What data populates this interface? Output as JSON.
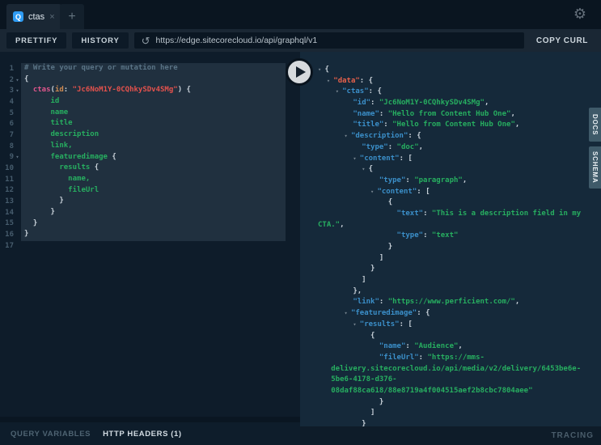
{
  "tabbar": {
    "active_tab": {
      "icon": "Q",
      "label": "ctas",
      "close": "×"
    },
    "new_tab": "+",
    "gear_icon": "⚙"
  },
  "toolbar": {
    "prettify": "PRETTIFY",
    "history": "HISTORY",
    "url": "https://edge.sitecorecloud.io/api/graphql/v1",
    "reload_icon": "↺",
    "copy_curl": "COPY CURL"
  },
  "side_tabs": [
    {
      "label": "DOCS"
    },
    {
      "label": "SCHEMA"
    }
  ],
  "bottom": {
    "query_variables": "QUERY VARIABLES",
    "http_headers": "HTTP HEADERS (1)",
    "tracing": "TRACING"
  },
  "colors": {
    "tab_icon_blue": "#2f9cf4",
    "field_green": "#27ae60",
    "key_blue": "#3b8fc9",
    "data_key_red": "#e8614b",
    "root_field_pink": "#e0568c",
    "string_red": "#e5524d",
    "arg_orange": "#cf8a50",
    "editor_bg": "#0e1c2a",
    "response_bg": "#15293a",
    "selection_bg": "#20303f",
    "side_tab_bg": "#3f5a69"
  },
  "editor": {
    "fold_arrow": "▾ ",
    "lines": [
      {
        "fold": false,
        "tokens": [
          [
            "com",
            "# Write your query or mutation here"
          ]
        ]
      },
      {
        "fold": true,
        "tokens": [
          [
            "punc",
            "{"
          ]
        ]
      },
      {
        "fold": true,
        "tokens": [
          [
            "punc",
            "  "
          ],
          [
            "root",
            "ctas"
          ],
          [
            "punc",
            "("
          ],
          [
            "arg",
            "id"
          ],
          [
            "punc",
            ": "
          ],
          [
            "str",
            "\"Jc6NoM1Y-0CQhkySDv4SMg\""
          ],
          [
            "punc",
            ") {"
          ]
        ]
      },
      {
        "fold": false,
        "tokens": [
          [
            "field",
            "      id"
          ]
        ]
      },
      {
        "fold": false,
        "tokens": [
          [
            "field",
            "      name"
          ]
        ]
      },
      {
        "fold": false,
        "tokens": [
          [
            "field",
            "      title"
          ]
        ]
      },
      {
        "fold": false,
        "tokens": [
          [
            "field",
            "      description"
          ]
        ]
      },
      {
        "fold": false,
        "tokens": [
          [
            "field",
            "      link,"
          ]
        ]
      },
      {
        "fold": true,
        "tokens": [
          [
            "field",
            "      featuredimage"
          ],
          [
            "punc",
            " {"
          ]
        ]
      },
      {
        "fold": false,
        "tokens": [
          [
            "field",
            "        results"
          ],
          [
            "punc",
            " {"
          ]
        ]
      },
      {
        "fold": false,
        "tokens": [
          [
            "field",
            "          name,"
          ]
        ]
      },
      {
        "fold": false,
        "tokens": [
          [
            "field",
            "          fileUrl"
          ]
        ]
      },
      {
        "fold": false,
        "tokens": [
          [
            "punc",
            "        }"
          ]
        ]
      },
      {
        "fold": false,
        "tokens": [
          [
            "punc",
            "      }"
          ]
        ]
      },
      {
        "fold": false,
        "tokens": [
          [
            "punc",
            "  }"
          ]
        ]
      },
      {
        "fold": false,
        "tokens": [
          [
            "punc",
            "}"
          ]
        ]
      },
      {
        "fold": false,
        "tokens": []
      }
    ]
  },
  "response": {
    "lines": [
      {
        "tokens": [
          [
            "arr",
            "▾ "
          ],
          [
            "punc",
            "{"
          ]
        ]
      },
      {
        "tokens": [
          [
            "punc",
            "  "
          ],
          [
            "arr",
            "▾ "
          ],
          [
            "keyd",
            "\"data\""
          ],
          [
            "punc",
            ": {"
          ]
        ]
      },
      {
        "tokens": [
          [
            "punc",
            "    "
          ],
          [
            "arr",
            "▾ "
          ],
          [
            "key",
            "\"ctas\""
          ],
          [
            "punc",
            ": {"
          ]
        ]
      },
      {
        "tokens": [
          [
            "punc",
            "        "
          ],
          [
            "key",
            "\"id\""
          ],
          [
            "punc",
            ": "
          ],
          [
            "val",
            "\"Jc6NoM1Y-0CQhkySDv4SMg\""
          ],
          [
            "punc",
            ","
          ]
        ]
      },
      {
        "tokens": [
          [
            "punc",
            "        "
          ],
          [
            "key",
            "\"name\""
          ],
          [
            "punc",
            ": "
          ],
          [
            "val",
            "\"Hello from Content Hub One\""
          ],
          [
            "punc",
            ","
          ]
        ]
      },
      {
        "tokens": [
          [
            "punc",
            "        "
          ],
          [
            "key",
            "\"title\""
          ],
          [
            "punc",
            ": "
          ],
          [
            "val",
            "\"Hello from Content Hub One\""
          ],
          [
            "punc",
            ","
          ]
        ]
      },
      {
        "tokens": [
          [
            "punc",
            "      "
          ],
          [
            "arr",
            "▾ "
          ],
          [
            "key",
            "\"description\""
          ],
          [
            "punc",
            ": {"
          ]
        ]
      },
      {
        "tokens": [
          [
            "punc",
            "          "
          ],
          [
            "key",
            "\"type\""
          ],
          [
            "punc",
            ": "
          ],
          [
            "val",
            "\"doc\""
          ],
          [
            "punc",
            ","
          ]
        ]
      },
      {
        "tokens": [
          [
            "punc",
            "        "
          ],
          [
            "arr",
            "▾ "
          ],
          [
            "key",
            "\"content\""
          ],
          [
            "punc",
            ": ["
          ]
        ]
      },
      {
        "tokens": [
          [
            "punc",
            "          "
          ],
          [
            "arr",
            "▾ "
          ],
          [
            "punc",
            "{"
          ]
        ]
      },
      {
        "tokens": [
          [
            "punc",
            "              "
          ],
          [
            "key",
            "\"type\""
          ],
          [
            "punc",
            ": "
          ],
          [
            "val",
            "\"paragraph\""
          ],
          [
            "punc",
            ","
          ]
        ]
      },
      {
        "tokens": [
          [
            "punc",
            "            "
          ],
          [
            "arr",
            "▾ "
          ],
          [
            "key",
            "\"content\""
          ],
          [
            "punc",
            ": ["
          ]
        ]
      },
      {
        "tokens": [
          [
            "punc",
            "                {"
          ]
        ]
      },
      {
        "tokens": [
          [
            "punc",
            "                  "
          ],
          [
            "key",
            "\"text\""
          ],
          [
            "punc",
            ": "
          ],
          [
            "val",
            "\"This is a description field in my"
          ]
        ]
      },
      {
        "tokens": [
          [
            "val",
            "CTA.\""
          ],
          [
            "punc",
            ","
          ]
        ]
      },
      {
        "tokens": [
          [
            "punc",
            "                  "
          ],
          [
            "key",
            "\"type\""
          ],
          [
            "punc",
            ": "
          ],
          [
            "val",
            "\"text\""
          ]
        ]
      },
      {
        "tokens": [
          [
            "punc",
            "                }"
          ]
        ]
      },
      {
        "tokens": [
          [
            "punc",
            "              ]"
          ]
        ]
      },
      {
        "tokens": [
          [
            "punc",
            "            }"
          ]
        ]
      },
      {
        "tokens": [
          [
            "punc",
            "          ]"
          ]
        ]
      },
      {
        "tokens": [
          [
            "punc",
            "        },"
          ]
        ]
      },
      {
        "tokens": [
          [
            "punc",
            "        "
          ],
          [
            "key",
            "\"link\""
          ],
          [
            "punc",
            ": "
          ],
          [
            "val",
            "\"https://www.perficient.com/\""
          ],
          [
            "punc",
            ","
          ]
        ]
      },
      {
        "tokens": [
          [
            "punc",
            "      "
          ],
          [
            "arr",
            "▾ "
          ],
          [
            "key",
            "\"featuredimage\""
          ],
          [
            "punc",
            ": {"
          ]
        ]
      },
      {
        "tokens": [
          [
            "punc",
            "        "
          ],
          [
            "arr",
            "▾ "
          ],
          [
            "key",
            "\"results\""
          ],
          [
            "punc",
            ": ["
          ]
        ]
      },
      {
        "tokens": [
          [
            "punc",
            "            {"
          ]
        ]
      },
      {
        "tokens": [
          [
            "punc",
            "              "
          ],
          [
            "key",
            "\"name\""
          ],
          [
            "punc",
            ": "
          ],
          [
            "val",
            "\"Audience\""
          ],
          [
            "punc",
            ","
          ]
        ]
      },
      {
        "tokens": [
          [
            "punc",
            "              "
          ],
          [
            "key",
            "\"fileUrl\""
          ],
          [
            "punc",
            ": "
          ],
          [
            "val",
            "\"https://mms-"
          ]
        ]
      },
      {
        "tokens": [
          [
            "val",
            "   delivery.sitecorecloud.io/api/media/v2/delivery/6453be6e-"
          ]
        ]
      },
      {
        "tokens": [
          [
            "val",
            "   5be6-4178-d376-"
          ]
        ]
      },
      {
        "tokens": [
          [
            "val",
            "   08daf88ca618/88e8719a4f004515aef2b8cbc7804aee\""
          ]
        ]
      },
      {
        "tokens": [
          [
            "punc",
            "              }"
          ]
        ]
      },
      {
        "tokens": [
          [
            "punc",
            "            ]"
          ]
        ]
      },
      {
        "tokens": [
          [
            "punc",
            "          }"
          ]
        ]
      }
    ]
  }
}
